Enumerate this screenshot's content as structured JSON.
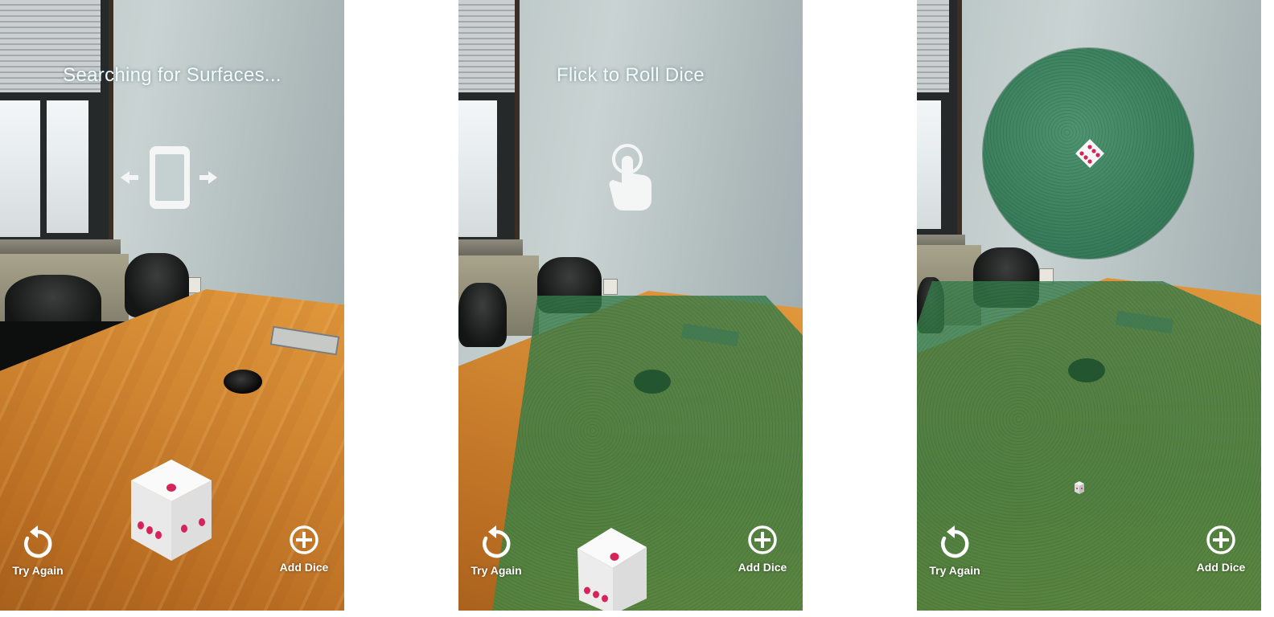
{
  "screens": [
    {
      "hint_text": "Searching for Surfaces...",
      "hint_icon": "phone-move-icon",
      "left_button": {
        "label": "Try Again",
        "icon": "restart-icon"
      },
      "right_button": {
        "label": "Add Dice",
        "icon": "plus-circle-icon"
      }
    },
    {
      "hint_text": "Flick to Roll Dice",
      "hint_icon": "hand-tap-icon",
      "left_button": {
        "label": "Try Again",
        "icon": "restart-icon"
      },
      "right_button": {
        "label": "Add Dice",
        "icon": "plus-circle-icon"
      }
    },
    {
      "hint_text": "",
      "hint_icon": "",
      "left_button": {
        "label": "Try Again",
        "icon": "restart-icon"
      },
      "right_button": {
        "label": "Add Dice",
        "icon": "plus-circle-icon"
      }
    }
  ],
  "colors": {
    "felt_green": "#3a7e5c",
    "table_wood": "#cf8430",
    "pip_red": "#d6245a",
    "hud_white": "#ffffff"
  }
}
